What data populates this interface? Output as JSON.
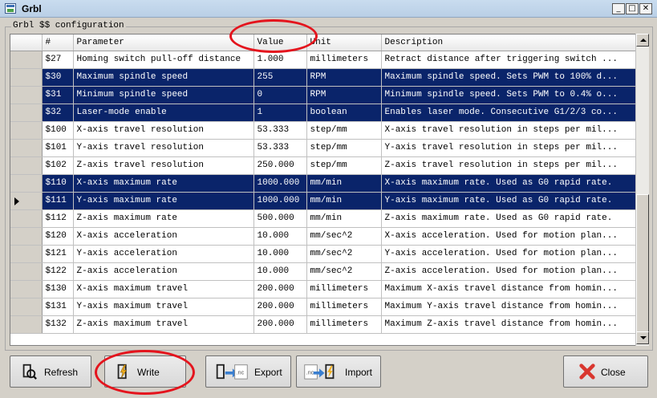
{
  "window": {
    "title": "Grbl",
    "minimize": "_",
    "maximize": "□",
    "close": "✕"
  },
  "group": {
    "label": "Grbl $$ configuration"
  },
  "columns": {
    "num": "#",
    "param": "Parameter",
    "value": "Value",
    "unit": "Unit",
    "desc": "Description"
  },
  "rows": [
    {
      "id": "$27",
      "param": "Homing switch pull-off distance",
      "value": "1.000",
      "unit": "millimeters",
      "desc": "Retract distance after triggering switch ...",
      "selected": false
    },
    {
      "id": "$30",
      "param": "Maximum spindle speed",
      "value": "255",
      "unit": "RPM",
      "desc": "Maximum spindle speed. Sets PWM to 100% d...",
      "selected": true
    },
    {
      "id": "$31",
      "param": "Minimum spindle speed",
      "value": "0",
      "unit": "RPM",
      "desc": "Minimum spindle speed. Sets PWM to 0.4% o...",
      "selected": true
    },
    {
      "id": "$32",
      "param": "Laser-mode enable",
      "value": "1",
      "unit": "boolean",
      "desc": "Enables laser mode. Consecutive G1/2/3 co...",
      "selected": true
    },
    {
      "id": "$100",
      "param": "X-axis travel resolution",
      "value": "53.333",
      "unit": "step/mm",
      "desc": "X-axis travel resolution in steps per mil...",
      "selected": false
    },
    {
      "id": "$101",
      "param": "Y-axis travel resolution",
      "value": "53.333",
      "unit": "step/mm",
      "desc": "Y-axis travel resolution in steps per mil...",
      "selected": false
    },
    {
      "id": "$102",
      "param": "Z-axis travel resolution",
      "value": "250.000",
      "unit": "step/mm",
      "desc": "Z-axis travel resolution in steps per mil...",
      "selected": false
    },
    {
      "id": "$110",
      "param": "X-axis maximum rate",
      "value": "1000.000",
      "unit": "mm/min",
      "desc": "X-axis maximum rate. Used as G0 rapid rate.",
      "selected": true
    },
    {
      "id": "$111",
      "param": "Y-axis maximum rate",
      "value": "1000.000",
      "unit": "mm/min",
      "desc": "Y-axis maximum rate. Used as G0 rapid rate.",
      "selected": true,
      "current": true
    },
    {
      "id": "$112",
      "param": "Z-axis maximum rate",
      "value": "500.000",
      "unit": "mm/min",
      "desc": "Z-axis maximum rate. Used as G0 rapid rate.",
      "selected": false
    },
    {
      "id": "$120",
      "param": "X-axis acceleration",
      "value": "10.000",
      "unit": "mm/sec^2",
      "desc": "X-axis acceleration. Used for motion plan...",
      "selected": false
    },
    {
      "id": "$121",
      "param": "Y-axis acceleration",
      "value": "10.000",
      "unit": "mm/sec^2",
      "desc": "Y-axis acceleration. Used for motion plan...",
      "selected": false
    },
    {
      "id": "$122",
      "param": "Z-axis acceleration",
      "value": "10.000",
      "unit": "mm/sec^2",
      "desc": "Z-axis acceleration. Used for motion plan...",
      "selected": false
    },
    {
      "id": "$130",
      "param": "X-axis maximum travel",
      "value": "200.000",
      "unit": "millimeters",
      "desc": "Maximum X-axis travel distance from homin...",
      "selected": false
    },
    {
      "id": "$131",
      "param": "Y-axis maximum travel",
      "value": "200.000",
      "unit": "millimeters",
      "desc": "Maximum Y-axis travel distance from homin...",
      "selected": false
    },
    {
      "id": "$132",
      "param": "Z-axis maximum travel",
      "value": "200.000",
      "unit": "millimeters",
      "desc": "Maximum Z-axis travel distance from homin...",
      "selected": false
    }
  ],
  "buttons": {
    "refresh": "Refresh",
    "write": "Write",
    "export": "Export",
    "import": "Import",
    "close": "Close",
    "nc_tag": ".nc"
  },
  "colors": {
    "selection": "#0a246a",
    "annotation": "#e4141d",
    "close_x": "#d9362e",
    "bolt": "#f2b01e"
  }
}
